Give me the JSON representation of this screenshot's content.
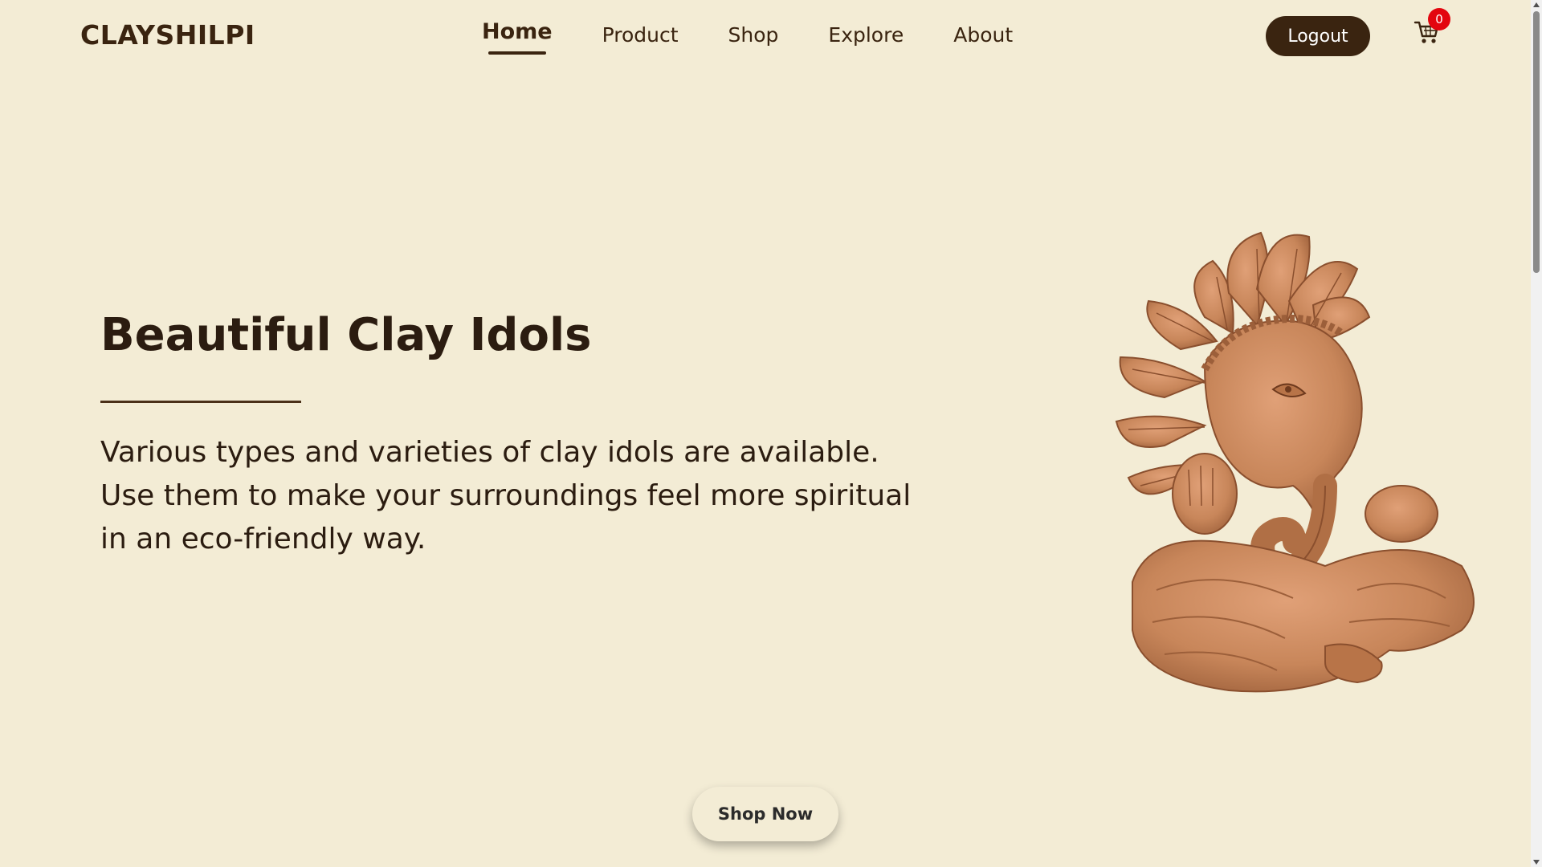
{
  "header": {
    "brand": "CLAYSHILPI",
    "nav": [
      {
        "label": "Home",
        "active": true
      },
      {
        "label": "Product",
        "active": false
      },
      {
        "label": "Shop",
        "active": false
      },
      {
        "label": "Explore",
        "active": false
      },
      {
        "label": "About",
        "active": false
      }
    ],
    "logout_label": "Logout",
    "cart_count": "0"
  },
  "hero": {
    "title": "Beautiful Clay Idols",
    "description": "Various types and varieties of clay idols are available. Use them to make your surroundings feel more spiritual in an eco-friendly way.",
    "cta_label": "Shop Now",
    "image": "clay-ganesha-idol"
  },
  "colors": {
    "background": "#f3ecd5",
    "brand_dark": "#3a2410",
    "badge": "#e3060f",
    "clay": "#c8865a"
  }
}
